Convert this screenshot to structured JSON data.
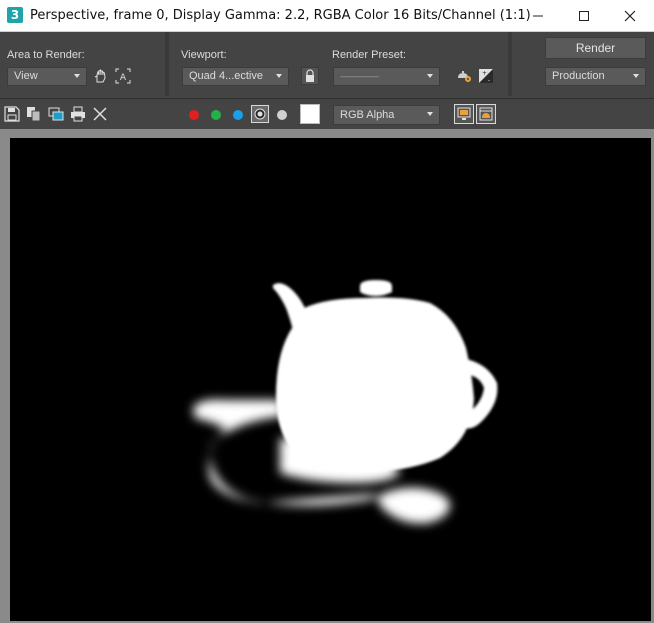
{
  "window": {
    "app_icon_text": "3",
    "title": "Perspective, frame 0, Display Gamma: 2.2, RGBA Color 16 Bits/Channel (1:1)"
  },
  "settings": {
    "area_label": "Area to Render:",
    "area_value": "View",
    "viewport_label": "Viewport:",
    "viewport_value": "Quad 4...ective",
    "preset_label": "Render Preset:",
    "preset_value": "-----------------------",
    "render_label": "Render",
    "production_value": "Production"
  },
  "toolbar": {
    "channel_value": "RGB Alpha",
    "colors": {
      "red": "#e02020",
      "green": "#21b34a",
      "blue": "#1aa0e8",
      "mono": "#d0d0d0"
    }
  },
  "render": {
    "background": "#000000",
    "subject": "white teapot alpha silhouette"
  }
}
